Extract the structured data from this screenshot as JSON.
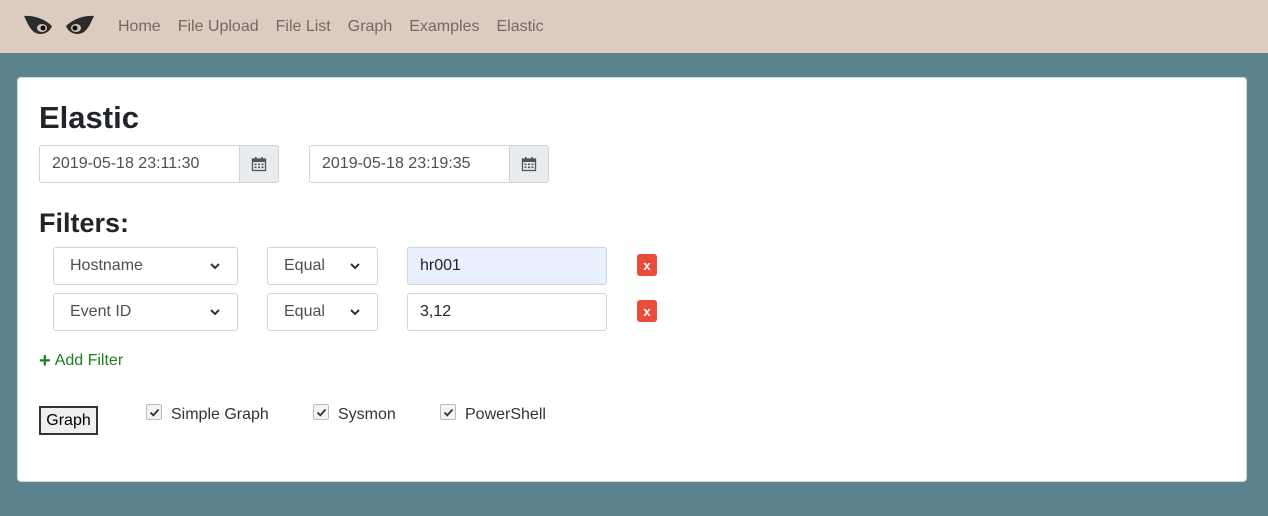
{
  "nav": {
    "items": [
      "Home",
      "File Upload",
      "File List",
      "Graph",
      "Examples",
      "Elastic"
    ]
  },
  "page": {
    "title": "Elastic"
  },
  "date_range": {
    "start": "2019-05-18 23:11:30",
    "end": "2019-05-18 23:19:35"
  },
  "filters": {
    "title": "Filters:",
    "rows": [
      {
        "field": "Hostname",
        "operator": "Equal",
        "value": "hr001",
        "remove": "x"
      },
      {
        "field": "Event ID",
        "operator": "Equal",
        "value": "3,12",
        "remove": "x"
      }
    ],
    "add_label": "Add Filter"
  },
  "actions": {
    "graph_label": "Graph",
    "options": [
      {
        "label": "Simple Graph",
        "checked": true
      },
      {
        "label": "Sysmon",
        "checked": true
      },
      {
        "label": "PowerShell",
        "checked": true
      }
    ]
  },
  "colors": {
    "navbar": "#decbc0",
    "background": "#5b838e",
    "remove": "#e74c3c",
    "add": "#1b7f1b",
    "autofill": "#e8f0fe"
  },
  "icons": {
    "logo": "owl-eyes-logo",
    "calendar": "calendar-icon",
    "dropdown": "chevron-down-icon",
    "add": "plus-icon",
    "check": "check-icon"
  }
}
